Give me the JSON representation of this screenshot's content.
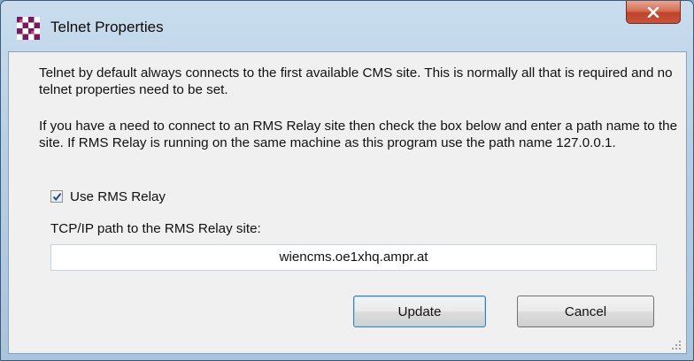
{
  "window": {
    "title": "Telnet Properties",
    "app_icon": "checkered-flag-icon",
    "close_icon": "close-icon",
    "accent_close": "#c9543b"
  },
  "dialog": {
    "paragraph1": "Telnet by default always connects to the first available CMS site. This is normally all that is required and no telnet properties need to be set.",
    "paragraph2": "If you have a need to connect to an RMS Relay site then check the box below and enter a path name to the site. If RMS Relay is running on the same machine as this program use the path name 127.0.0.1.",
    "checkbox": {
      "label": "Use RMS Relay",
      "checked": true
    },
    "path_label": "TCP/IP path to the RMS Relay site:",
    "path_value": "wiencms.oe1xhq.ampr.at",
    "buttons": {
      "update": "Update",
      "cancel": "Cancel"
    }
  }
}
